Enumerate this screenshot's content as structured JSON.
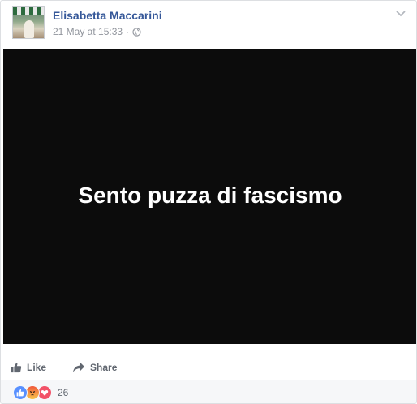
{
  "post": {
    "author": "Elisabetta Maccarini",
    "timestamp": "21 May at 15:33",
    "separator": "·",
    "privacy_icon": "globe-icon",
    "menu_icon": "chevron-down-icon",
    "media_text": "Sento puzza di fascismo",
    "media_background": "#0c0c0c"
  },
  "actions": {
    "like_label": "Like",
    "share_label": "Share"
  },
  "reactions": {
    "types": [
      "like",
      "angry",
      "love"
    ],
    "count": "26"
  },
  "colors": {
    "author_link": "#365899",
    "meta_text": "#90949c",
    "action_text": "#616770",
    "like_blue": "#5890ff"
  }
}
